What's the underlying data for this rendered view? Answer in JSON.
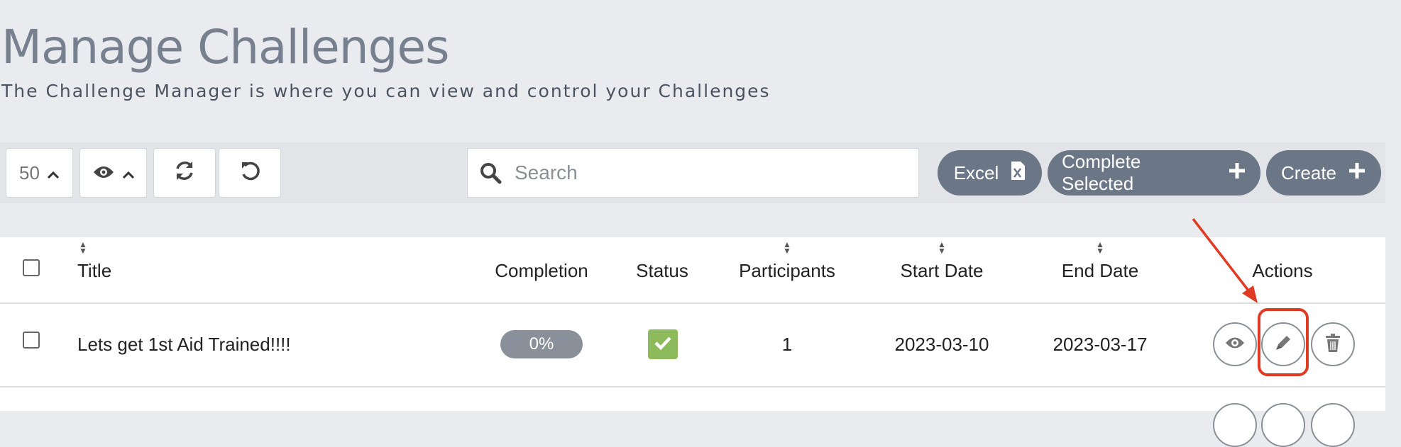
{
  "header": {
    "title": "Manage Challenges",
    "subtitle": "The Challenge Manager is where you can view and control your Challenges"
  },
  "toolbar": {
    "page_size": "50",
    "search_placeholder": "Search",
    "excel_label": "Excel",
    "complete_selected_label": "Complete Selected",
    "create_label": "Create",
    "pill_color": "#6b7686"
  },
  "table": {
    "columns": [
      "Title",
      "Completion",
      "Status",
      "Participants",
      "Start Date",
      "End Date",
      "Actions"
    ],
    "rows": [
      {
        "title": "Lets get 1st Aid Trained!!!!",
        "completion": "0%",
        "status": "checked",
        "participants": "1",
        "start_date": "2023-03-10",
        "end_date": "2023-03-17"
      }
    ]
  },
  "icons": {
    "toolbar": [
      "chevron-up-icon",
      "eye-icon",
      "refresh-icon",
      "undo-icon",
      "search-icon",
      "excel-icon",
      "plus-icon"
    ],
    "actions": [
      "eye-icon",
      "pencil-icon",
      "trash-icon"
    ]
  },
  "annotation": {
    "color": "#e03a22",
    "target": "edit-button"
  }
}
